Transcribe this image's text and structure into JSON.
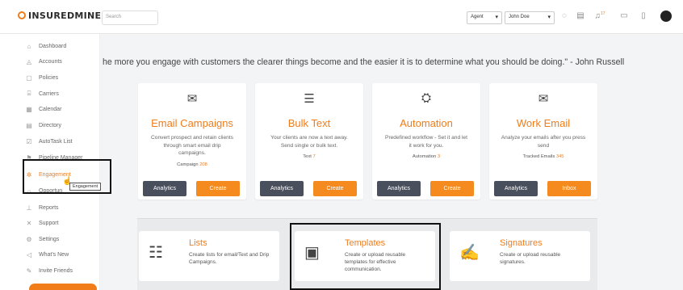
{
  "app": {
    "logo": "INSUREDMINE"
  },
  "topbar": {
    "search_placeholder": "Search",
    "role_select": "Agent",
    "user_select": "John Doe",
    "notification_count": "17"
  },
  "sidebar": {
    "items": [
      {
        "label": "Dashboard",
        "icon": "home-icon"
      },
      {
        "label": "Accounts",
        "icon": "accounts-icon"
      },
      {
        "label": "Policies",
        "icon": "policies-icon"
      },
      {
        "label": "Carriers",
        "icon": "carriers-icon"
      },
      {
        "label": "Calendar",
        "icon": "calendar-icon"
      },
      {
        "label": "Directory",
        "icon": "directory-icon"
      },
      {
        "label": "AutoTask List",
        "icon": "autotask-icon"
      },
      {
        "label": "Pipeline Manager",
        "icon": "pipeline-icon"
      },
      {
        "label": "Engagement",
        "icon": "engagement-icon"
      },
      {
        "label": "Opportun",
        "icon": "opportunities-icon"
      },
      {
        "label": "Reports",
        "icon": "reports-icon"
      },
      {
        "label": "Support",
        "icon": "support-icon"
      },
      {
        "label": "Settings",
        "icon": "settings-icon"
      },
      {
        "label": "What's New",
        "icon": "whats-new-icon"
      },
      {
        "label": "Invite Friends",
        "icon": "invite-icon"
      }
    ],
    "tooltip": "Engagement"
  },
  "quote": "he more you engage with customers the clearer things become and the easier it is to determine what you should be doing.\" - John Russell",
  "cards": [
    {
      "title": "Email Campaigns",
      "desc": "Convert prospect and retain clients through smart email drip campaigns.",
      "stat_label": "Campaign",
      "stat_value": "208",
      "btn1": "Analytics",
      "btn2": "Create"
    },
    {
      "title": "Bulk Text",
      "desc": "Your clients are now a text away. Send single or bulk text.",
      "stat_label": "Text",
      "stat_value": "7",
      "btn1": "Analytics",
      "btn2": "Create"
    },
    {
      "title": "Automation",
      "desc": "Predefined workflow - Set it and let it work for you.",
      "stat_label": "Automation",
      "stat_value": "3",
      "btn1": "Analytics",
      "btn2": "Create"
    },
    {
      "title": "Work Email",
      "desc": "Analyze your emails after you press send",
      "stat_label": "Tracked Emails",
      "stat_value": "345",
      "btn1": "Analytics",
      "btn2": "Inbox"
    }
  ],
  "features": [
    {
      "title": "Lists",
      "desc": "Create lists for email/Text and Drip Campaigns."
    },
    {
      "title": "Templates",
      "desc": "Create or upload reusable templates for effective communication."
    },
    {
      "title": "Signatures",
      "desc": "Create or upload reusable signatures."
    }
  ],
  "colors": {
    "accent": "#f07d1a",
    "dark_button": "#4a4f5e"
  }
}
